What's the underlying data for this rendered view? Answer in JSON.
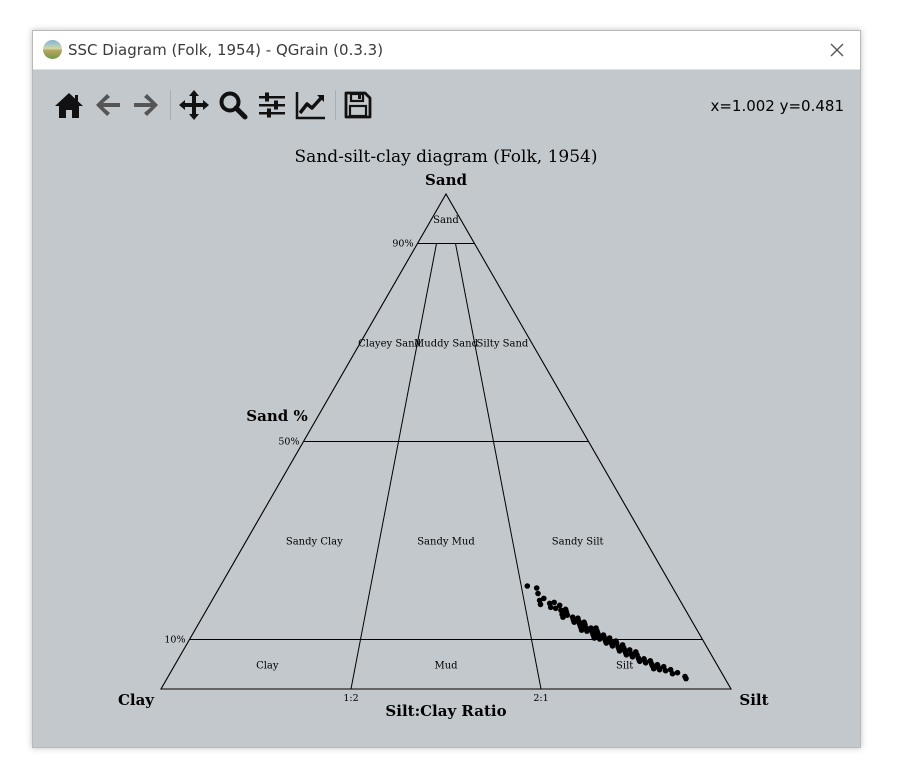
{
  "window": {
    "title": "SSC Diagram (Folk, 1954) - QGrain (0.3.3)"
  },
  "toolbar": {
    "buttons": [
      {
        "name": "home",
        "icon": "home-icon"
      },
      {
        "name": "back",
        "icon": "arrow-left-icon"
      },
      {
        "name": "forward",
        "icon": "arrow-right-icon"
      },
      {
        "name": "pan",
        "icon": "move-icon"
      },
      {
        "name": "zoom",
        "icon": "magnifier-icon"
      },
      {
        "name": "configure-subplots",
        "icon": "sliders-icon"
      },
      {
        "name": "edit-axis",
        "icon": "line-chart-icon"
      },
      {
        "name": "save",
        "icon": "floppy-disk-icon"
      }
    ],
    "coordinates": "x=1.002 y=0.481"
  },
  "chart_data": {
    "type": "scatter",
    "title": "Sand-silt-clay diagram (Folk, 1954)",
    "ternary": true,
    "vertices": {
      "top": "Sand",
      "left": "Clay",
      "right": "Silt"
    },
    "left_axis_label": "Sand %",
    "bottom_axis_label": "Silt:Clay Ratio",
    "sand_ticks": [
      {
        "label": "90%",
        "value": 90
      },
      {
        "label": "50%",
        "value": 50
      },
      {
        "label": "10%",
        "value": 10
      }
    ],
    "ratio_ticks": [
      {
        "label": "1:2",
        "silt_fraction": 0.3333
      },
      {
        "label": "2:1",
        "silt_fraction": 0.6667
      }
    ],
    "regions": [
      {
        "label": "Sand",
        "sand": 95,
        "silt_fraction": 0.5
      },
      {
        "label": "Clayey Sand",
        "sand": 70,
        "silt_fraction": 0.17
      },
      {
        "label": "Muddy Sand",
        "sand": 70,
        "silt_fraction": 0.5
      },
      {
        "label": "Silty Sand",
        "sand": 70,
        "silt_fraction": 0.83
      },
      {
        "label": "Sandy Clay",
        "sand": 30,
        "silt_fraction": 0.17
      },
      {
        "label": "Sandy Mud",
        "sand": 30,
        "silt_fraction": 0.5
      },
      {
        "label": "Sandy Silt",
        "sand": 30,
        "silt_fraction": 0.83
      },
      {
        "label": "Clay",
        "sand": 5,
        "silt_fraction": 0.17
      },
      {
        "label": "Mud",
        "sand": 5,
        "silt_fraction": 0.5
      },
      {
        "label": "Silt",
        "sand": 5,
        "silt_fraction": 0.83
      }
    ],
    "points": [
      [
        0.68,
        20.8
      ],
      [
        0.7,
        20.4
      ],
      [
        0.7,
        19.3
      ],
      [
        0.7,
        17.9
      ],
      [
        0.7,
        17.1
      ],
      [
        0.71,
        18.3
      ],
      [
        0.72,
        17.3
      ],
      [
        0.72,
        16.5
      ],
      [
        0.73,
        17.5
      ],
      [
        0.73,
        16.3
      ],
      [
        0.74,
        16.9
      ],
      [
        0.74,
        15.9
      ],
      [
        0.74,
        15.1
      ],
      [
        0.75,
        16.1
      ],
      [
        0.75,
        15.3
      ],
      [
        0.75,
        14.9
      ],
      [
        0.76,
        14.1
      ],
      [
        0.76,
        13.9
      ],
      [
        0.76,
        14.5
      ],
      [
        0.77,
        13.3
      ],
      [
        0.77,
        14.3
      ],
      [
        0.77,
        12.5
      ],
      [
        0.77,
        12.9
      ],
      [
        0.78,
        13.1
      ],
      [
        0.78,
        12.1
      ],
      [
        0.78,
        12.9
      ],
      [
        0.78,
        11.7
      ],
      [
        0.79,
        11.9
      ],
      [
        0.79,
        11.1
      ],
      [
        0.79,
        12.3
      ],
      [
        0.79,
        10.7
      ],
      [
        0.8,
        11.3
      ],
      [
        0.8,
        10.5
      ],
      [
        0.8,
        11.7
      ],
      [
        0.8,
        10.1
      ],
      [
        0.81,
        10.9
      ],
      [
        0.81,
        9.9
      ],
      [
        0.81,
        10.5
      ],
      [
        0.81,
        9.3
      ],
      [
        0.82,
        9.7
      ],
      [
        0.82,
        10.3
      ],
      [
        0.82,
        9.1
      ],
      [
        0.82,
        8.7
      ],
      [
        0.83,
        9.3
      ],
      [
        0.83,
        8.5
      ],
      [
        0.83,
        8.1
      ],
      [
        0.83,
        9.7
      ],
      [
        0.84,
        8.9
      ],
      [
        0.84,
        7.7
      ],
      [
        0.84,
        8.3
      ],
      [
        0.84,
        7.3
      ],
      [
        0.85,
        7.9
      ],
      [
        0.85,
        7.1
      ],
      [
        0.85,
        6.7
      ],
      [
        0.86,
        7.5
      ],
      [
        0.86,
        6.3
      ],
      [
        0.86,
        6.9
      ],
      [
        0.86,
        5.9
      ],
      [
        0.87,
        6.1
      ],
      [
        0.87,
        5.5
      ],
      [
        0.88,
        5.7
      ],
      [
        0.88,
        5.1
      ],
      [
        0.88,
        4.7
      ],
      [
        0.89,
        4.9
      ],
      [
        0.89,
        4.3
      ],
      [
        0.9,
        4.5
      ],
      [
        0.9,
        3.7
      ],
      [
        0.91,
        3.9
      ],
      [
        0.92,
        3.3
      ],
      [
        0.93,
        2.5
      ],
      [
        0.93,
        2.1
      ],
      [
        0.76,
        13.5
      ],
      [
        0.78,
        12.3
      ],
      [
        0.8,
        10.9
      ],
      [
        0.82,
        8.9
      ],
      [
        0.84,
        7.9
      ],
      [
        0.85,
        6.5
      ],
      [
        0.87,
        5.3
      ],
      [
        0.89,
        3.9
      ],
      [
        0.91,
        3.1
      ],
      [
        0.74,
        14.5
      ],
      [
        0.75,
        15.7
      ],
      [
        0.77,
        13.7
      ],
      [
        0.79,
        11.5
      ],
      [
        0.81,
        9.6
      ],
      [
        0.83,
        7.7
      ],
      [
        0.86,
        5.6
      ],
      [
        0.88,
        4.1
      ],
      [
        0.79,
        10.3
      ],
      [
        0.77,
        11.9
      ],
      [
        0.82,
        9.4
      ],
      [
        0.84,
        6.9
      ],
      [
        0.86,
        6.0
      ],
      [
        0.8,
        12.3
      ],
      [
        0.78,
        13.5
      ]
    ],
    "point_fields": [
      "silt_fraction_of_mud",
      "sand_percent"
    ]
  }
}
